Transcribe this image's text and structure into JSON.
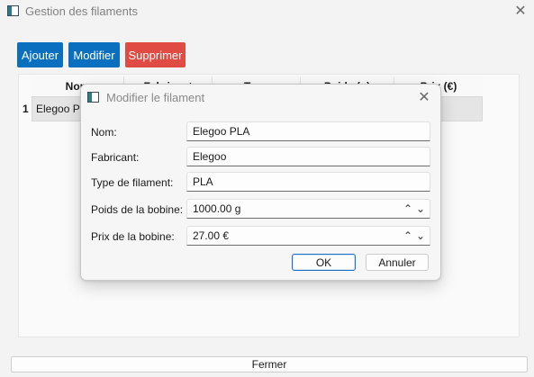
{
  "window": {
    "title": "Gestion des filaments",
    "close_glyph": "✕"
  },
  "toolbar": {
    "add_label": "Ajouter",
    "edit_label": "Modifier",
    "delete_label": "Supprimer"
  },
  "table": {
    "headers": [
      "Nom",
      "Fabricant",
      "Type",
      "Poids (g)",
      "Prix (€)"
    ],
    "rows": [
      {
        "index": "1",
        "name": "Elegoo PLA"
      }
    ]
  },
  "footer": {
    "close_label": "Fermer"
  },
  "dialog": {
    "title": "Modifier le filament",
    "close_glyph": "✕",
    "fields": {
      "name": {
        "label": "Nom:",
        "value": "Elegoo PLA"
      },
      "manufacturer": {
        "label": "Fabricant:",
        "value": "Elegoo"
      },
      "type": {
        "label": "Type de filament:",
        "value": "PLA"
      },
      "weight": {
        "label": "Poids de la bobine:",
        "value": "1000.00 g"
      },
      "price": {
        "label": "Prix de la bobine:",
        "value": "27.00 €"
      }
    },
    "spin_up_glyph": "⌃",
    "spin_down_glyph": "⌄",
    "ok_label": "OK",
    "cancel_label": "Annuler"
  },
  "colors": {
    "accent": "#0b6fc0",
    "danger": "#e04b43"
  }
}
